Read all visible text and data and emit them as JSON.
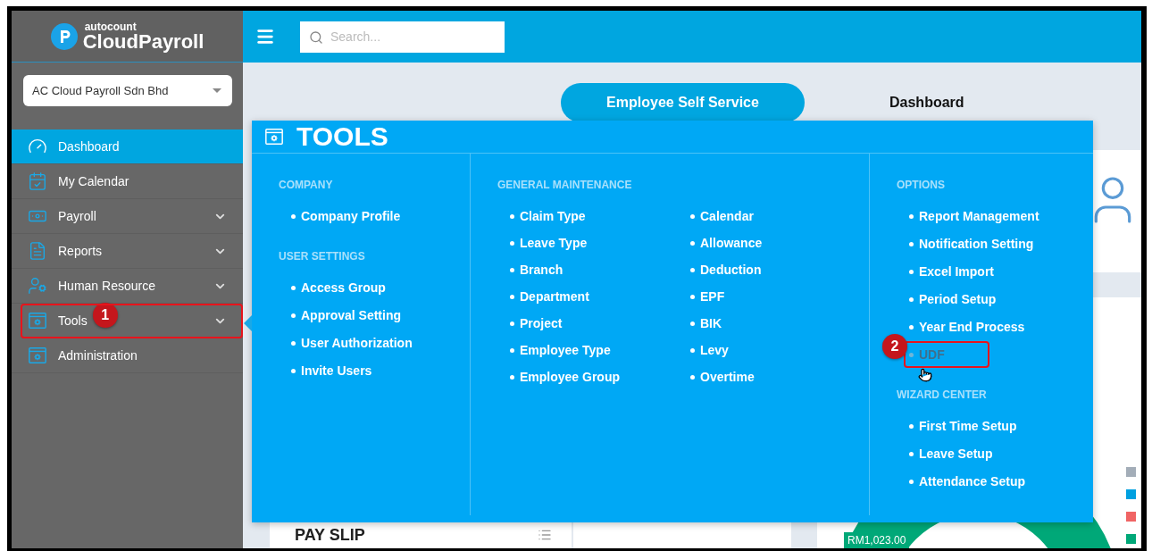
{
  "app": {
    "brand_small": "autocount",
    "brand_name": "CloudPayroll"
  },
  "search": {
    "placeholder": "Search..."
  },
  "company_select": {
    "value": "AC Cloud Payroll Sdn Bhd"
  },
  "sidebar": {
    "items": [
      {
        "label": "Dashboard",
        "selected": true,
        "has_submenu": false
      },
      {
        "label": "My Calendar",
        "selected": false,
        "has_submenu": false
      },
      {
        "label": "Payroll",
        "selected": false,
        "has_submenu": true
      },
      {
        "label": "Reports",
        "selected": false,
        "has_submenu": true
      },
      {
        "label": "Human Resource",
        "selected": false,
        "has_submenu": true
      },
      {
        "label": "Tools",
        "selected": false,
        "has_submenu": true,
        "callout": "1"
      },
      {
        "label": "Administration",
        "selected": false,
        "has_submenu": false
      }
    ]
  },
  "header": {
    "button": "Employee Self Service",
    "tab": "Dashboard"
  },
  "tools_menu": {
    "title": "TOOLS",
    "columns": [
      {
        "sections": [
          {
            "heading": "COMPANY",
            "items": [
              {
                "label": "Company Profile",
                "hovered": false
              }
            ]
          },
          {
            "heading": "USER SETTINGS",
            "items": [
              {
                "label": "Access Group",
                "hovered": false
              },
              {
                "label": "Approval Setting",
                "hovered": false
              },
              {
                "label": "User Authorization",
                "hovered": false
              },
              {
                "label": "Invite Users",
                "hovered": false
              }
            ]
          }
        ]
      },
      {
        "sections": [
          {
            "heading": "GENERAL MAINTENANCE",
            "items": [
              {
                "label": "Claim Type",
                "hovered": false
              },
              {
                "label": "Leave Type",
                "hovered": false
              },
              {
                "label": "Branch",
                "hovered": false
              },
              {
                "label": "Department",
                "hovered": false
              },
              {
                "label": "Project",
                "hovered": false
              },
              {
                "label": "Employee Type",
                "hovered": false
              },
              {
                "label": "Employee Group",
                "hovered": false
              },
              {
                "label": "Calendar",
                "hovered": false
              },
              {
                "label": "Allowance",
                "hovered": false
              },
              {
                "label": "Deduction",
                "hovered": false
              },
              {
                "label": "EPF",
                "hovered": false
              },
              {
                "label": "BIK",
                "hovered": false
              },
              {
                "label": "Levy",
                "hovered": false
              },
              {
                "label": "Overtime",
                "hovered": false
              }
            ]
          }
        ]
      },
      {
        "sections": [
          {
            "heading": "OPTIONS",
            "items": [
              {
                "label": "Report Management",
                "hovered": false
              },
              {
                "label": "Notification Setting",
                "hovered": false
              },
              {
                "label": "Excel Import",
                "hovered": false
              },
              {
                "label": "Period Setup",
                "hovered": false
              },
              {
                "label": "Year End Process",
                "hovered": false
              },
              {
                "label": "UDF",
                "hovered": true,
                "callout": "2"
              }
            ]
          },
          {
            "heading": "WIZARD CENTER",
            "items": [
              {
                "label": "First Time Setup",
                "hovered": false
              },
              {
                "label": "Leave Setup",
                "hovered": false
              },
              {
                "label": "Attendance Setup",
                "hovered": false
              }
            ]
          }
        ]
      }
    ]
  },
  "cards": {
    "payslip_title": "PAY SLIP",
    "donut_label": "RM1,023.00"
  },
  "legend": [
    {
      "color": "#a3adb8"
    },
    {
      "color": "#00a0e0"
    },
    {
      "color": "#f06464"
    },
    {
      "color": "#00a878"
    }
  ]
}
